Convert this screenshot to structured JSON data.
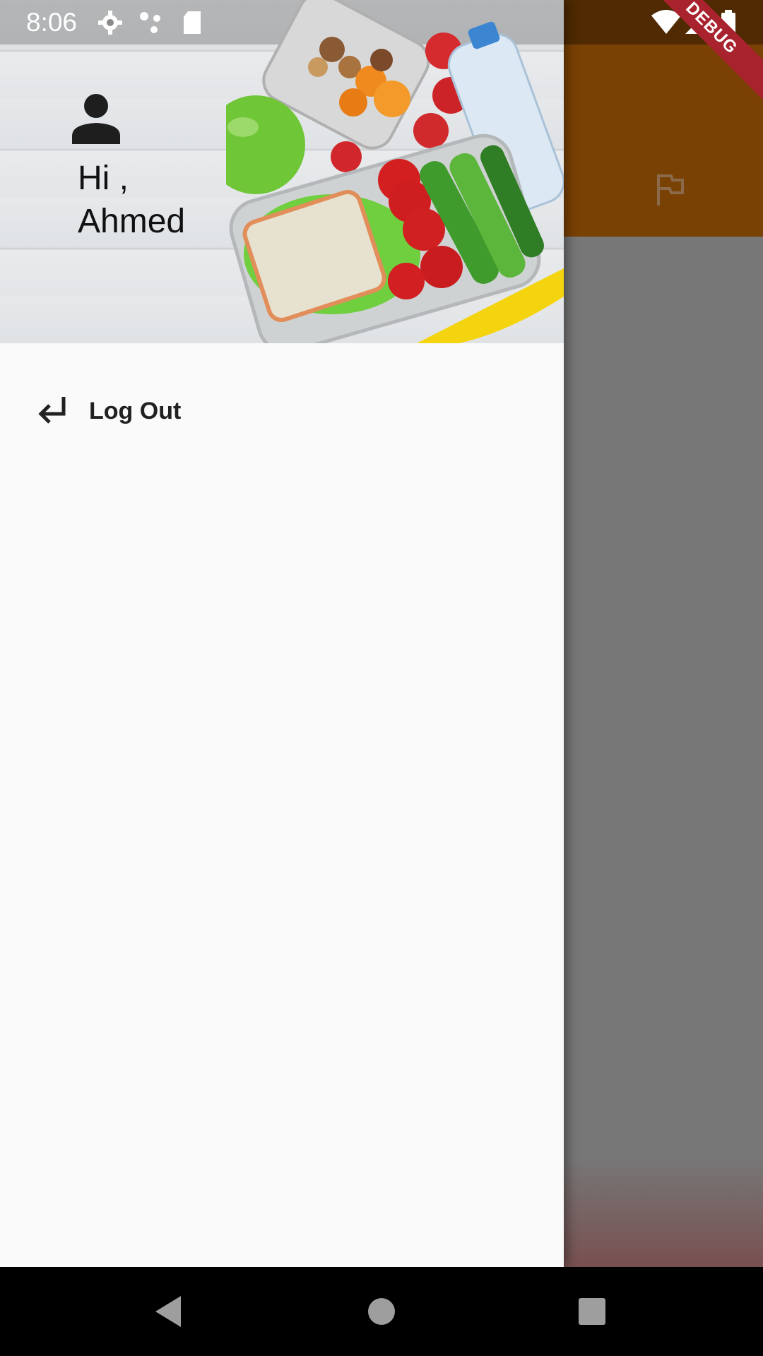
{
  "status_bar": {
    "time": "8:06",
    "icons": [
      "settings-icon",
      "dots-icon",
      "sd-card-icon",
      "wifi-icon",
      "signal-icon",
      "battery-icon"
    ]
  },
  "debug_banner": {
    "label": "DEBUG",
    "color": "#a9232e"
  },
  "app": {
    "app_bar_color": "#7a4104",
    "action_icon": "flag-icon"
  },
  "drawer": {
    "greeting": "Hi ,\nAhmed",
    "avatar_icon": "person-icon",
    "menu_items": [
      {
        "label": "Log Out",
        "icon": "return-arrow-icon"
      }
    ]
  },
  "nav_bar": {
    "buttons": [
      "back-icon",
      "home-icon",
      "recents-icon"
    ]
  }
}
